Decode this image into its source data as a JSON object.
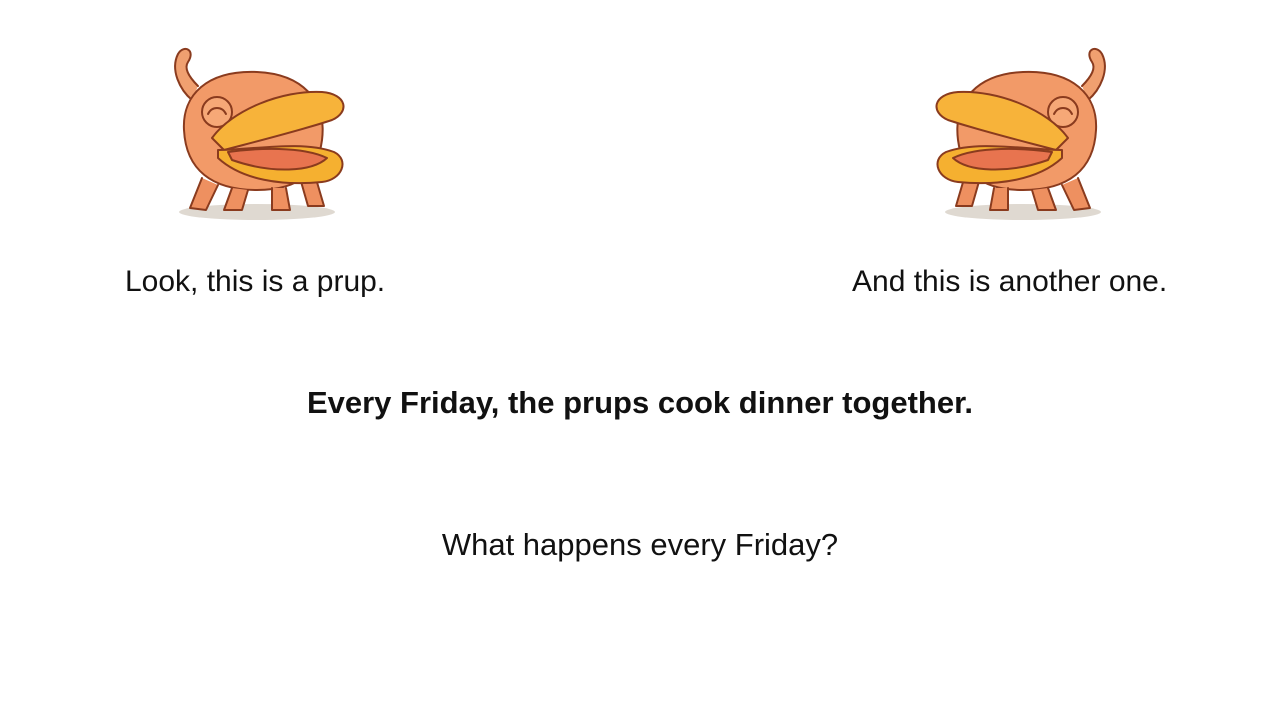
{
  "slide": {
    "caption_left": "Look, this is a prup.",
    "caption_right": "And this is another one.",
    "statement": "Every Friday, the prups cook dinner together.",
    "question": "What happens every Friday?"
  },
  "illustrations": {
    "left": {
      "icon": "prup-creature-icon",
      "facing": "right"
    },
    "right": {
      "icon": "prup-creature-icon",
      "facing": "left"
    }
  },
  "colors": {
    "body": "#f29a68",
    "beak": "#f7b33a",
    "mouth": "#e8744f",
    "outline": "#8a3b1e"
  }
}
